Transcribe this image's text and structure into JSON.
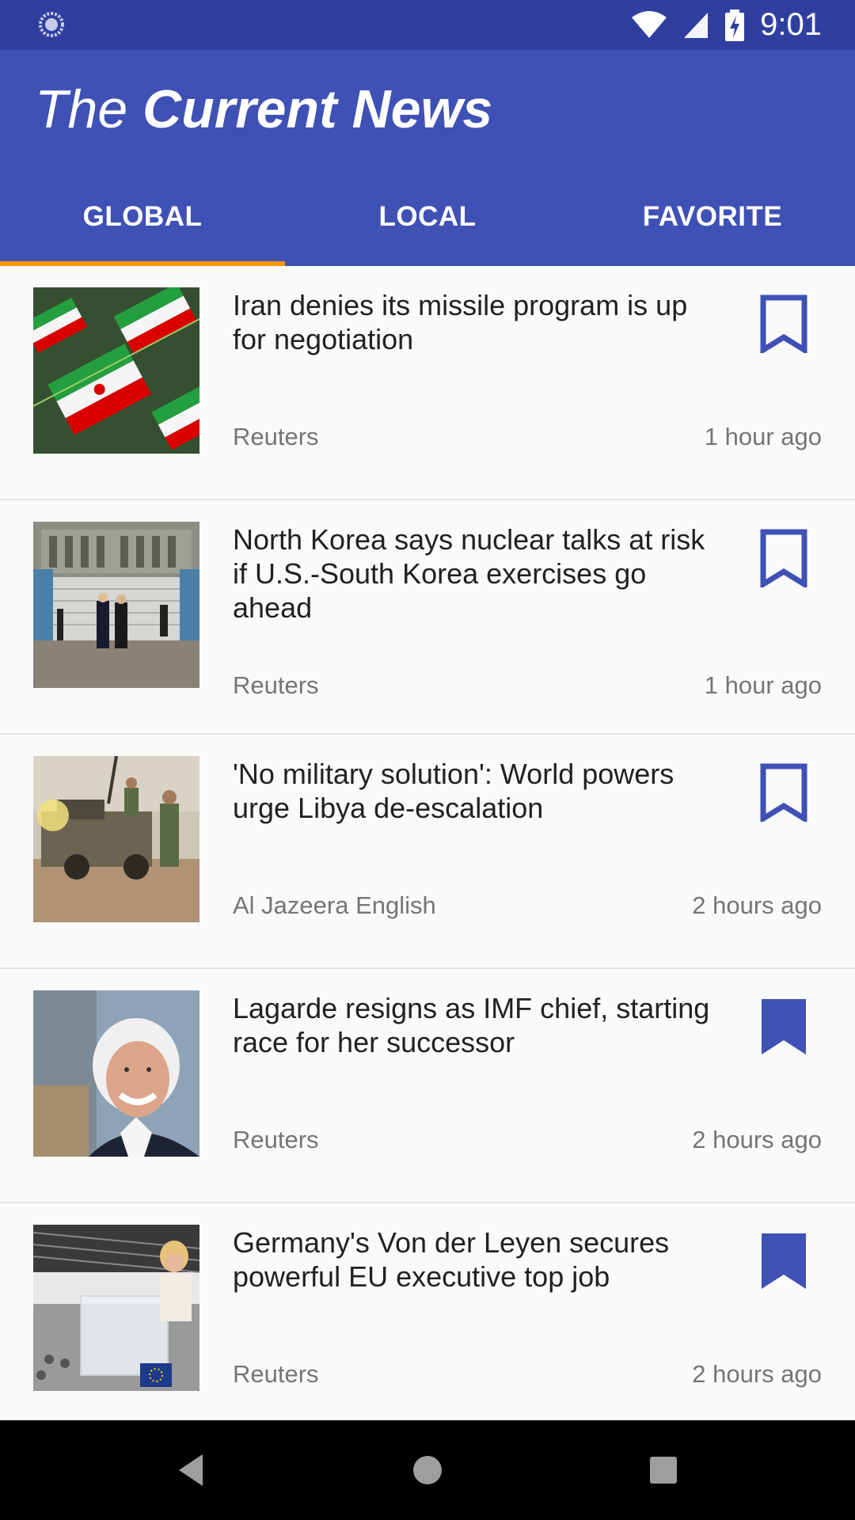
{
  "status_bar": {
    "time": "9:01",
    "icons": [
      "sync-icon",
      "wifi-icon",
      "cell-signal-icon",
      "battery-charging-icon"
    ]
  },
  "app_bar": {
    "title_light": "The",
    "title_bold": "Current News",
    "background": "#3f51b5",
    "status_background": "#303f9f"
  },
  "tabs": [
    {
      "label": "GLOBAL",
      "active": true
    },
    {
      "label": "LOCAL",
      "active": false
    },
    {
      "label": "FAVORITE",
      "active": false
    }
  ],
  "tab_indicator_color": "#ff9800",
  "accent_color": "#3f51b5",
  "articles": [
    {
      "headline": "Iran denies its missile program is up for negotiation",
      "source": "Reuters",
      "time": "1 hour ago",
      "bookmarked": false,
      "image": "iran-flags-photo"
    },
    {
      "headline": "North Korea says nuclear talks at risk if U.S.-South Korea exercises go ahead",
      "source": "Reuters",
      "time": "1 hour ago",
      "bookmarked": false,
      "image": "dmz-leaders-photo"
    },
    {
      "headline": "'No military solution': World powers urge Libya de-escalation",
      "source": "Al Jazeera English",
      "time": "2 hours ago",
      "bookmarked": false,
      "image": "libya-soldiers-photo"
    },
    {
      "headline": "Lagarde resigns as IMF chief, starting race for her successor",
      "source": "Reuters",
      "time": "2 hours ago",
      "bookmarked": true,
      "image": "lagarde-portrait-photo"
    },
    {
      "headline": "Germany's Von der Leyen secures powerful EU executive top job",
      "source": "Reuters",
      "time": "2 hours ago",
      "bookmarked": true,
      "image": "eu-parliament-photo"
    }
  ],
  "nav_bar": {
    "buttons": [
      "back-icon",
      "home-icon",
      "recents-icon"
    ]
  }
}
